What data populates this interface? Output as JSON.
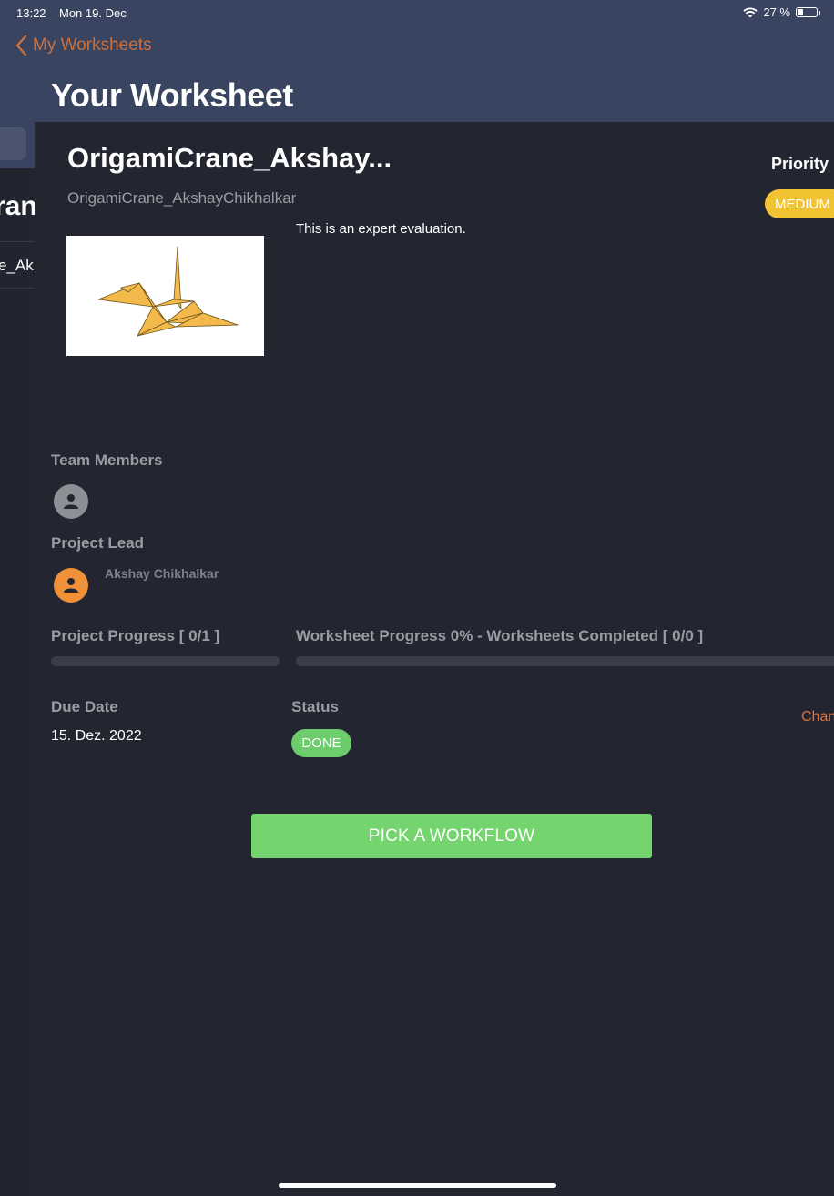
{
  "status_bar": {
    "time": "13:22",
    "date": "Mon 19. Dec",
    "battery": "27 %"
  },
  "nav": {
    "back_label": "My Worksheets",
    "page_title": "Your Worksheet"
  },
  "background_list": {
    "title_fragment": "ran",
    "item_fragment": "e_Ak"
  },
  "worksheet": {
    "title": "OrigamiCrane_Akshay...",
    "subtitle": "OrigamiCrane_AkshayChikhalkar",
    "description": "This is an expert evaluation.",
    "priority_label": "Priority",
    "priority_value": "MEDIUM",
    "team_members_label": "Team Members",
    "project_lead_label": "Project Lead",
    "project_lead_name": "Akshay Chikhalkar",
    "project_progress_label": "Project Progress [ 0/1 ]",
    "project_progress_fraction": 0,
    "worksheet_progress_label": "Worksheet Progress 0% - Worksheets Completed [ 0/0 ]",
    "worksheet_progress_fraction": 0,
    "due_date_label": "Due Date",
    "due_date_value": "15. Dez. 2022",
    "status_label": "Status",
    "status_value": "DONE",
    "change_link": "Chan",
    "pick_workflow_button": "PICK A WORKFLOW"
  },
  "colors": {
    "header_bg": "#394460",
    "accent_orange": "#c9703e",
    "priority_yellow": "#f1c232",
    "done_green": "#6dcd6d",
    "button_green": "#74d56f"
  }
}
